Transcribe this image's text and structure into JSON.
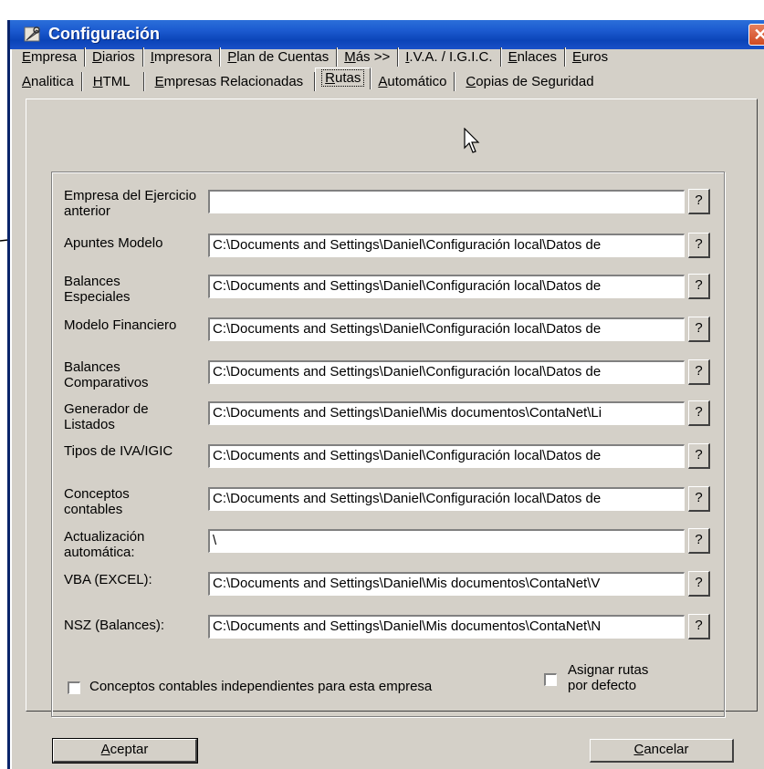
{
  "window": {
    "title": "Configuración",
    "close_glyph": "✕"
  },
  "tabs_row1": [
    {
      "pre": "",
      "key": "E",
      "post": "mpresa"
    },
    {
      "pre": "",
      "key": "D",
      "post": "iarios"
    },
    {
      "pre": "",
      "key": "I",
      "post": "mpresora"
    },
    {
      "pre": "",
      "key": "P",
      "post": "lan de Cuentas"
    },
    {
      "pre": "",
      "key": "M",
      "post": "ás >>"
    },
    {
      "pre": "",
      "key": "I",
      "post": ".V.A. / I.G.I.C."
    },
    {
      "pre": "",
      "key": "E",
      "post": "nlaces"
    },
    {
      "pre": "",
      "key": "E",
      "post": "uros"
    }
  ],
  "tabs_row2": [
    {
      "pre": "",
      "key": "A",
      "post": "nalitica"
    },
    {
      "pre": "",
      "key": "H",
      "post": "TML"
    },
    {
      "pre": "",
      "key": "E",
      "post": "mpresas Relacionadas"
    },
    {
      "pre": "",
      "key": "R",
      "post": "utas",
      "active": true
    },
    {
      "pre": "",
      "key": "A",
      "post": "utomático"
    },
    {
      "pre": "",
      "key": "C",
      "post": "opias de Seguridad"
    }
  ],
  "paths": [
    {
      "label": "Empresa del Ejercicio anterior",
      "value": ""
    },
    {
      "label": "Apuntes Modelo",
      "value": "C:\\Documents and Settings\\Daniel\\Configuración local\\Datos de"
    },
    {
      "label": "Balances Especiales",
      "value": "C:\\Documents and Settings\\Daniel\\Configuración local\\Datos de"
    },
    {
      "label": "Modelo Financiero",
      "value": "C:\\Documents and Settings\\Daniel\\Configuración local\\Datos de"
    },
    {
      "label": "Balances Comparativos",
      "value": "C:\\Documents and Settings\\Daniel\\Configuración local\\Datos de"
    },
    {
      "label": "Generador de Listados",
      "value": "C:\\Documents and Settings\\Daniel\\Mis documentos\\ContaNet\\Li"
    },
    {
      "label": "Tipos de IVA/IGIC",
      "value": "C:\\Documents and Settings\\Daniel\\Configuración local\\Datos de"
    },
    {
      "label": "Conceptos contables",
      "value": "C:\\Documents and Settings\\Daniel\\Configuración local\\Datos de"
    },
    {
      "label": "Actualización automática:",
      "value": "\\"
    },
    {
      "label": "VBA (EXCEL):",
      "value": "C:\\Documents and Settings\\Daniel\\Mis documentos\\ContaNet\\V"
    },
    {
      "label": "NSZ (Balances):",
      "value": "C:\\Documents and Settings\\Daniel\\Mis documentos\\ContaNet\\N"
    }
  ],
  "browse_label": "?",
  "checkboxes": {
    "independent": "Conceptos contables independientes para esta empresa",
    "default_paths": "Asignar rutas por defecto"
  },
  "buttons": {
    "ok": {
      "key": "A",
      "post": "ceptar"
    },
    "cancel": {
      "key": "C",
      "post": "ancelar"
    }
  }
}
